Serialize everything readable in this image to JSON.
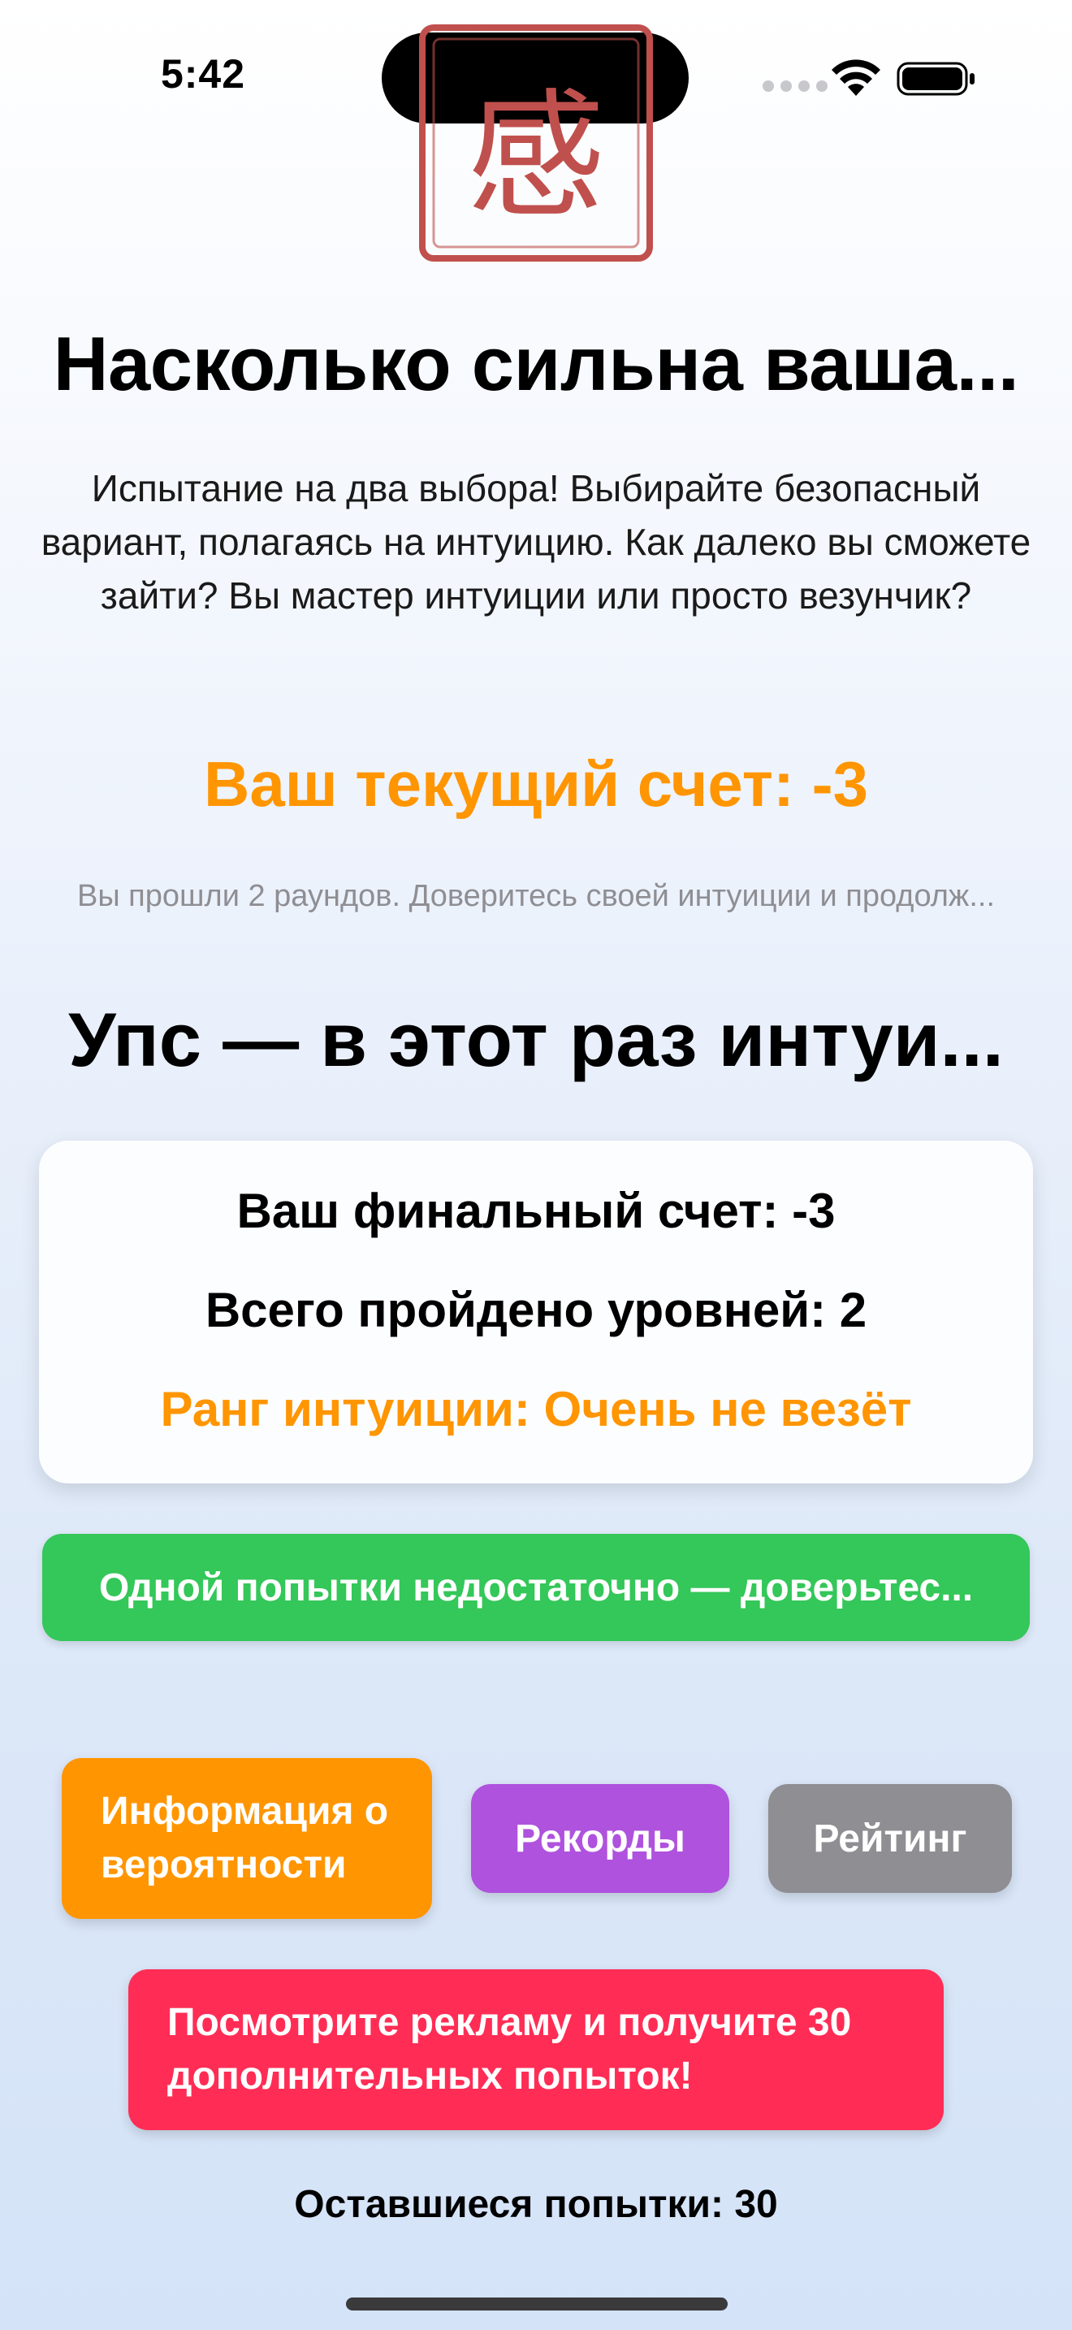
{
  "status_bar": {
    "time": "5:42"
  },
  "logo": {
    "glyph": "感",
    "color": "#c0504d"
  },
  "header": {
    "title": "Насколько сильна ваша...",
    "description": "Испытание на два выбора! Выбирайте безопасный вариант, полагаясь на интуицию. Как далеко вы сможете зайти? Вы мастер интуиции или просто везунчик?"
  },
  "score": {
    "current": "Ваш текущий счет: -3",
    "progress": "Вы прошли 2 раундов. Доверитесь своей интуиции и продолж..."
  },
  "result": {
    "title": "Упс — в этот раз интуи...",
    "final_score": "Ваш финальный счет: -3",
    "levels_passed": "Всего пройдено уровней: 2",
    "rank": "Ранг интуиции: Очень не везёт"
  },
  "buttons": {
    "retry": "Одной попытки недостаточно — доверьтес...",
    "probability": "Информация о вероятности",
    "records": "Рекорды",
    "rating": "Рейтинг",
    "watch_ad": "Посмотрите рекламу и получите 30 дополнительных попыток!"
  },
  "footer": {
    "attempts_left": "Оставшиеся попытки: 30"
  },
  "colors": {
    "accent_orange": "#ff9500",
    "green": "#34c759",
    "purple": "#af52de",
    "gray": "#8e8e93",
    "red": "#ff2d55"
  }
}
